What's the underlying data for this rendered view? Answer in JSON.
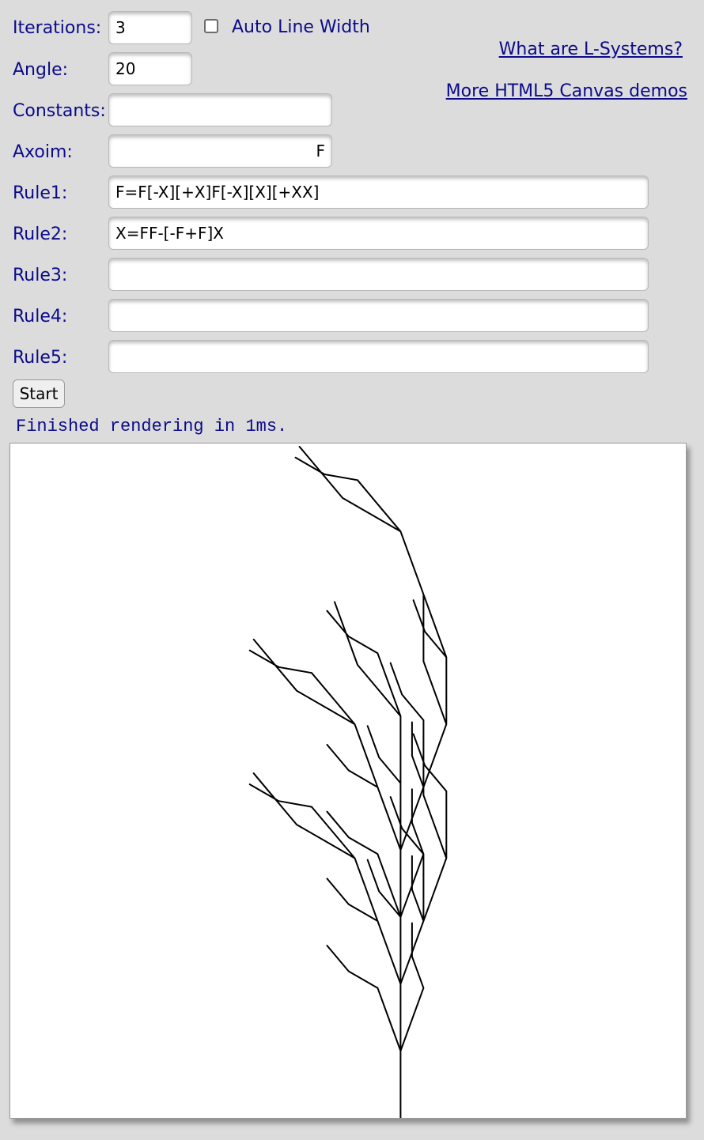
{
  "form": {
    "iterations_label": "Iterations:",
    "iterations_value": "3",
    "auto_line_width_label": "Auto Line Width",
    "auto_line_width_checked": false,
    "angle_label": "Angle:",
    "angle_value": "20",
    "constants_label": "Constants:",
    "constants_value": "",
    "axiom_label": "Axoim:",
    "axiom_value": "F",
    "rules": [
      {
        "label": "Rule1:",
        "value": "F=F[-X][+X]F[-X][X][+XX]"
      },
      {
        "label": "Rule2:",
        "value": "X=FF-[-F+F]X"
      },
      {
        "label": "Rule3:",
        "value": ""
      },
      {
        "label": "Rule4:",
        "value": ""
      },
      {
        "label": "Rule5:",
        "value": ""
      }
    ],
    "start_label": "Start"
  },
  "links": {
    "what_are": "What are L-Systems?",
    "more_demos": "More HTML5 Canvas demos"
  },
  "status": {
    "message": "Finished rendering in 1ms."
  },
  "colors": {
    "background": "#dcdcdc",
    "label_text": "#0b0b8a",
    "stroke": "#000000"
  }
}
